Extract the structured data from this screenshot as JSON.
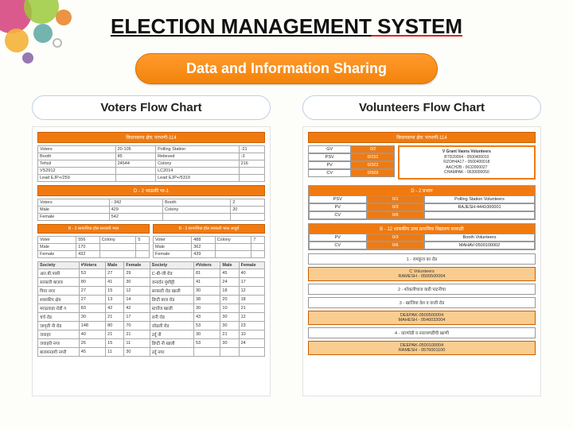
{
  "title_part1": "ELECTION MANAGEMENT",
  "title_part2": " SYSTEM",
  "subtitle": "Data and Information Sharing",
  "left": {
    "header": "Voters Flow Chart",
    "topbar": "विधानसभा क्षेत्र: परभणी-114",
    "summary": [
      [
        "Voters",
        "20-105",
        "Polling Station",
        "-21"
      ],
      [
        "Booth",
        "45",
        "Relieved",
        "-3"
      ],
      [
        "Tehsil",
        "24544",
        "Colony",
        "216"
      ],
      [
        "VS2912",
        "",
        "LC2014",
        ""
      ],
      [
        "Lead EJP+/259",
        "",
        "Lead EJP+/5319",
        ""
      ]
    ],
    "mid_title": "D - 2 भाऊकी भा-1",
    "mid_rows": [
      [
        "Voters",
        "- 342",
        "Booth",
        "2"
      ],
      [
        "Male",
        "429",
        "Colony",
        "20"
      ],
      [
        "Female",
        "542",
        "",
        ""
      ]
    ],
    "dual_left_title": "B - 2 सामाजिक हॉल सरकारी भाल",
    "dual_left_rows": [
      [
        "Voter",
        "556",
        "Colony",
        "5"
      ],
      [
        "Male",
        "170",
        "",
        ""
      ],
      [
        "Female",
        "432",
        "",
        ""
      ]
    ],
    "dual_right_title": "B - 3 सामाजिक हॉल सरकारी भाल आयुर्व",
    "dual_right_rows": [
      [
        "Voter",
        "488",
        "Colony",
        "7"
      ],
      [
        "Male",
        "362",
        "",
        ""
      ],
      [
        "Female",
        "439",
        "",
        ""
      ]
    ],
    "big_headers": [
      "Society",
      "#Voters",
      "Male",
      "Female",
      "Society",
      "#Voters",
      "Male",
      "Female"
    ],
    "big_rows": [
      [
        "आर.बी.पासी",
        "53",
        "27",
        "29",
        "C-बी-जी रोड",
        "81",
        "45",
        "40"
      ],
      [
        "सरकारी बाजार",
        "80",
        "41",
        "30",
        "जनार्दन मुंशीट्टी",
        "41",
        "24",
        "17"
      ],
      [
        "पिया नगर",
        "27",
        "15",
        "12",
        "सरकारी रोड खाली",
        "30",
        "18",
        "12"
      ],
      [
        "शासकीय क्षेत्र",
        "27",
        "13",
        "14",
        "डिप्टी बाज रोड",
        "38",
        "20",
        "18"
      ],
      [
        "मराठवाडा रोडी ग",
        "83",
        "42",
        "42",
        "स्टार्वेज खाली",
        "30",
        "10",
        "21"
      ],
      [
        "चर्च रोड",
        "30",
        "21",
        "17",
        "रानी रोड",
        "43",
        "30",
        "12"
      ],
      [
        "जागृती नी रोड",
        "148",
        "80",
        "70",
        "जोडली रोड",
        "53",
        "30",
        "23"
      ],
      [
        "जवाहर",
        "40",
        "21",
        "21",
        "उर्दू नी",
        "30",
        "21",
        "10"
      ],
      [
        "जवाहरी नगर",
        "26",
        "15",
        "11",
        "डिप्टी नी खाली",
        "53",
        "30",
        "24"
      ],
      [
        "बारामनडगी नगरी",
        "45",
        "11",
        "30",
        "उर्दू नगर",
        "",
        "",
        ""
      ]
    ]
  },
  "right": {
    "header": "Volunteers Flow Chart",
    "topbar": "विधानसभा क्षेत्र: परभणी-114",
    "top_left_labels": [
      "GV",
      "PSV",
      "PV",
      "CV"
    ],
    "top_left_vals": [
      "0/2",
      "0/151",
      "0/322",
      "0/569"
    ],
    "top_right_title": "V Grant Vaons Volunteers",
    "top_right_lines": [
      "BTD20004 - 0500400010",
      "RZOH4A17 - 0500400018",
      "AACH2B - 0632000027",
      "CHAMPAK - 0639000050"
    ],
    "sec1_title": "D - 2 प्रभाग",
    "sec1_rows": [
      [
        "PSV",
        "0/1",
        "Polling Station Volunteers"
      ],
      [
        "PV",
        "0/3",
        "RAJESH-4441000001"
      ],
      [
        "CV",
        "0/6",
        ""
      ]
    ],
    "sec2_title": "B - 12 शासकीय उच्च प्राथमिक विद्यालय साकळी",
    "sec2_rows": [
      [
        "PV",
        "0/3",
        "Booth Volunteers"
      ],
      [
        "CV",
        "0/6",
        "MAHAV-0500100002"
      ]
    ],
    "blocks": [
      {
        "t": "1 - रामकुंज का रोड",
        "sub": "C Volunteers",
        "line": "RAMESH - 0500500004"
      },
      {
        "t": "2 - शोकलीचाज वाडी पाटनीचा",
        "sub": "",
        "line": ""
      },
      {
        "t": "3 - खाजिया वेश व वाजी रोड",
        "sub": "DEEPAK-0500500004\nMAHESH - 0546033004",
        "line": ""
      },
      {
        "t": "4 - वारणोडी व नारायणडींची खाणी",
        "sub": "DEEPAK-0500100004\nRAMESH - 0576001100",
        "line": ""
      }
    ]
  }
}
